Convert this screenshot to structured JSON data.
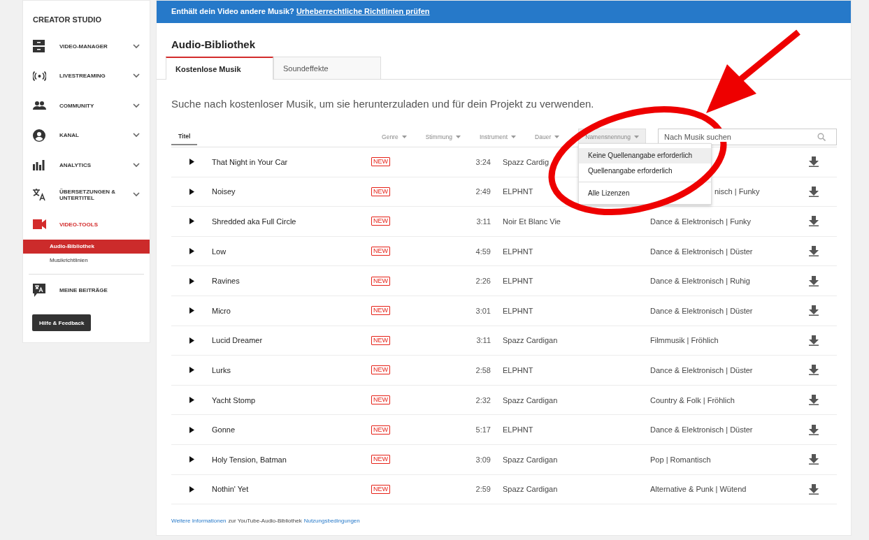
{
  "sidebar": {
    "title": "CREATOR STUDIO",
    "items": [
      {
        "kind": "manager",
        "label": "VIDEO-MANAGER",
        "expandable": true,
        "selected": false
      },
      {
        "kind": "live",
        "label": "LIVESTREAMING",
        "expandable": true,
        "selected": false
      },
      {
        "kind": "community",
        "label": "COMMUNITY",
        "expandable": true,
        "selected": false
      },
      {
        "kind": "channel",
        "label": "KANAL",
        "expandable": true,
        "selected": false
      },
      {
        "kind": "analytics",
        "label": "ANALYTICS",
        "expandable": true,
        "selected": false
      },
      {
        "kind": "translate",
        "label": "ÜBERSETZUNGEN & UNTERTITEL",
        "expandable": true,
        "selected": false
      },
      {
        "kind": "camera",
        "label": "VIDEO-TOOLS",
        "expandable": false,
        "selected": true,
        "children": [
          {
            "label": "Audio-Bibliothek",
            "selected": true
          },
          {
            "label": "Musikrichtlinien",
            "selected": false
          }
        ]
      },
      {
        "kind": "contrib",
        "label": "MEINE BEITRÄGE",
        "expandable": false,
        "selected": false
      }
    ],
    "help_button": "Hilfe & Feedback"
  },
  "banner": {
    "text": "Enthält dein Video andere Musik?",
    "link": "Urheberrechtliche Richtlinien prüfen"
  },
  "page_title": "Audio-Bibliothek",
  "tabs": [
    {
      "label": "Kostenlose Musik",
      "selected": true
    },
    {
      "label": "Soundeffekte",
      "selected": false
    }
  ],
  "description": "Suche nach kostenloser Musik, um sie herunterzuladen und für dein Projekt zu verwenden.",
  "filters": [
    {
      "label": "Titel",
      "kind": "tab",
      "selected": true
    },
    {
      "label": "Genre",
      "kind": "dropdown",
      "selected": false
    },
    {
      "label": "Stimmung",
      "kind": "dropdown",
      "selected": false
    },
    {
      "label": "Instrument",
      "kind": "dropdown",
      "selected": false
    },
    {
      "label": "Dauer",
      "kind": "dropdown",
      "selected": false
    },
    {
      "label": "Namensnennung",
      "kind": "dropdown",
      "selected": true
    }
  ],
  "search": {
    "placeholder": "Nach Musik suchen"
  },
  "menu": {
    "items": [
      {
        "label": "Keine Quellenangabe erforderlich",
        "selected": true
      },
      {
        "label": "Quellenangabe erforderlich",
        "selected": false
      },
      {
        "kind": "divider"
      },
      {
        "label": "Alle Lizenzen",
        "selected": false
      }
    ]
  },
  "tracks": [
    {
      "title": "That Night in Your Car",
      "badge": "NEW",
      "duration": "3:24",
      "artist": "Spazz Cardig"
    },
    {
      "title": "Noisey",
      "badge": "NEW",
      "duration": "2:49",
      "artist": "ELPHNT",
      "genre": "nisch | Funky",
      "cut_by_menu": true
    },
    {
      "title": "Shredded aka Full Circle",
      "badge": "NEW",
      "duration": "3:11",
      "artist": "Noir Et Blanc Vie",
      "genre": "Dance & Elektronisch | Funky"
    },
    {
      "title": "Low",
      "badge": "NEW",
      "duration": "4:59",
      "artist": "ELPHNT",
      "genre": "Dance & Elektronisch | Düster"
    },
    {
      "title": "Ravines",
      "badge": "NEW",
      "duration": "2:26",
      "artist": "ELPHNT",
      "genre": "Dance & Elektronisch | Ruhig"
    },
    {
      "title": "Micro",
      "badge": "NEW",
      "duration": "3:01",
      "artist": "ELPHNT",
      "genre": "Dance & Elektronisch | Düster"
    },
    {
      "title": "Lucid Dreamer",
      "badge": "NEW",
      "duration": "3:11",
      "artist": "Spazz Cardigan",
      "genre": "Filmmusik | Fröhlich"
    },
    {
      "title": "Lurks",
      "badge": "NEW",
      "duration": "2:58",
      "artist": "ELPHNT",
      "genre": "Dance & Elektronisch | Düster"
    },
    {
      "title": "Yacht Stomp",
      "badge": "NEW",
      "duration": "2:32",
      "artist": "Spazz Cardigan",
      "genre": "Country & Folk | Fröhlich"
    },
    {
      "title": "Gonne",
      "badge": "NEW",
      "duration": "5:17",
      "artist": "ELPHNT",
      "genre": "Dance & Elektronisch | Düster"
    },
    {
      "title": "Holy Tension, Batman",
      "badge": "NEW",
      "duration": "3:09",
      "artist": "Spazz Cardigan",
      "genre": "Pop | Romantisch"
    },
    {
      "title": "Nothin' Yet",
      "badge": "NEW",
      "duration": "2:59",
      "artist": "Spazz Cardigan",
      "genre": "Alternative & Punk | Wütend"
    }
  ],
  "footer": {
    "link": "Weitere Informationen",
    "text": "zur YouTube-Audio-Bibliothek",
    "link2": "Nutzungsbedingungen"
  },
  "annotations": [
    {
      "kind": "arrow"
    },
    {
      "kind": "ellipse"
    }
  ]
}
